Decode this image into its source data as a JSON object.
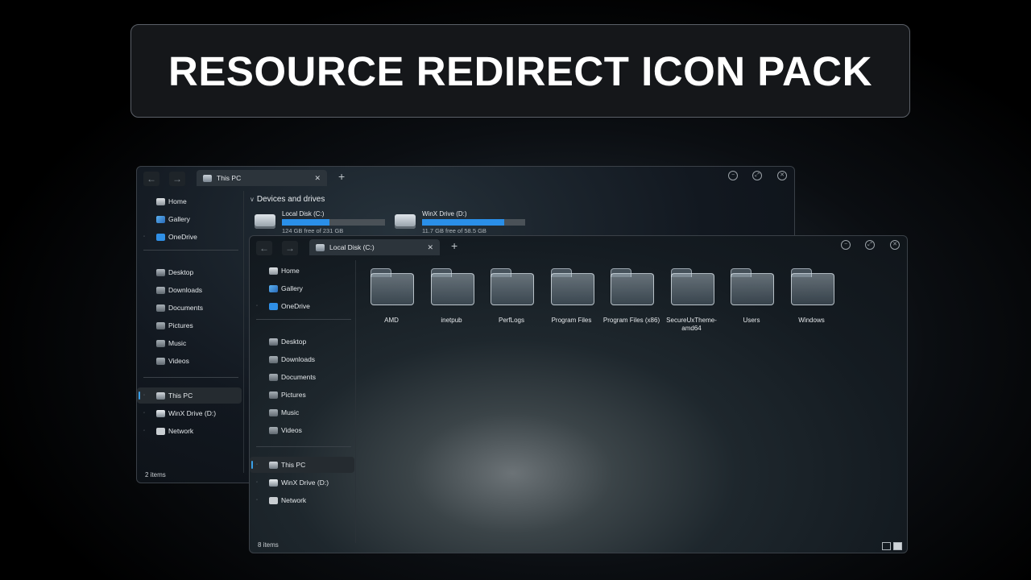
{
  "banner": {
    "title": "RESOURCE REDIRECT ICON PACK"
  },
  "window1": {
    "tab": {
      "label": "This PC"
    },
    "sidebar": {
      "home": "Home",
      "gallery": "Gallery",
      "onedrive": "OneDrive",
      "desktop": "Desktop",
      "downloads": "Downloads",
      "documents": "Documents",
      "pictures": "Pictures",
      "music": "Music",
      "videos": "Videos",
      "thispc": "This PC",
      "winx": "WinX Drive (D:)",
      "network": "Network"
    },
    "section_title": "Devices and drives",
    "drives": [
      {
        "name": "Local Disk (C:)",
        "free": "124 GB free of 231 GB",
        "used_fraction": 0.46
      },
      {
        "name": "WinX Drive (D:)",
        "free": "11.7 GB free of 58.5 GB",
        "used_fraction": 0.8
      }
    ],
    "status": "2 items"
  },
  "window2": {
    "tab": {
      "label": "Local Disk (C:)"
    },
    "sidebar": {
      "home": "Home",
      "gallery": "Gallery",
      "onedrive": "OneDrive",
      "desktop": "Desktop",
      "downloads": "Downloads",
      "documents": "Documents",
      "pictures": "Pictures",
      "music": "Music",
      "videos": "Videos",
      "thispc": "This PC",
      "winx": "WinX Drive (D:)",
      "network": "Network"
    },
    "folders": [
      "AMD",
      "inetpub",
      "PerfLogs",
      "Program Files",
      "Program Files (x86)",
      "SecureUxTheme-amd64",
      "Users",
      "Windows"
    ],
    "status": "8 items"
  },
  "colors": {
    "accent": "#2a8fe8",
    "selection_bar": "#3aa0e8"
  }
}
